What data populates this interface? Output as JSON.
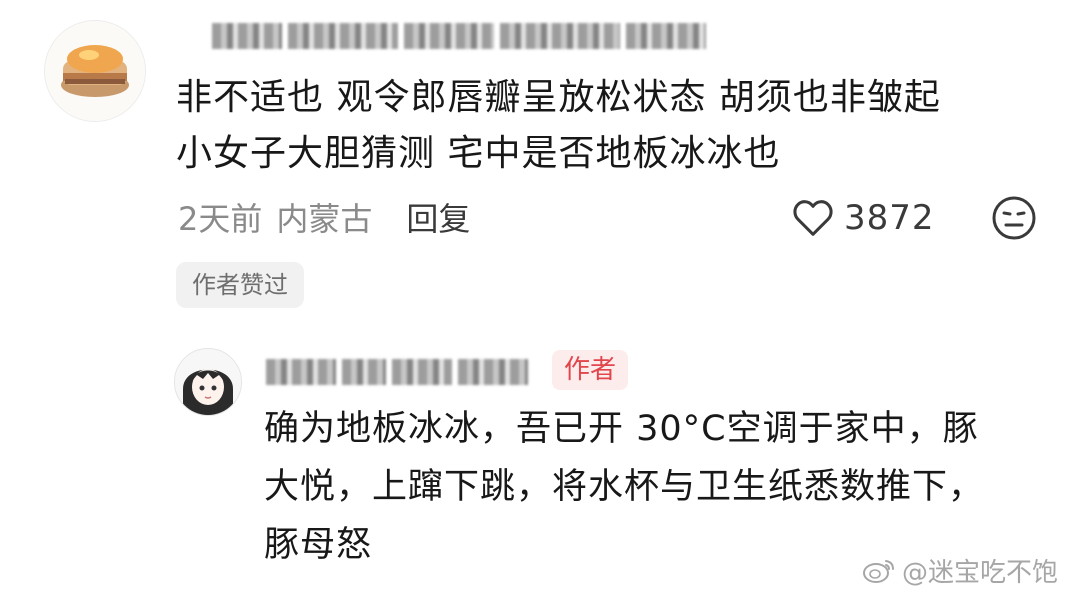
{
  "comment": {
    "avatar_icon": "toast-food-avatar-icon",
    "lines": [
      "非不适也  观令郎唇瓣呈放松状态  胡须也非皱起",
      "小女子大胆猜测  宅中是否地板冰冰也"
    ],
    "time": "2天前",
    "location": "内蒙古",
    "reply_label": "回复",
    "like_count": "3872",
    "like_icon": "heart-outline-icon",
    "emoji_icon": "neutral-face-icon",
    "author_liked_label": "作者赞过"
  },
  "reply": {
    "avatar_icon": "anime-character-avatar-icon",
    "author_badge": "作者",
    "lines": [
      "确为地板冰冰，吾已开 30°C空调于家中，豚",
      "大悦，上蹿下跳，将水杯与卫生纸悉数推下，",
      "豚母怒"
    ]
  },
  "watermark": {
    "icon": "weibo-logo-icon",
    "text": "@迷宝吃不饱"
  },
  "colors": {
    "badge_text": "#e0464b",
    "badge_bg": "#fdecec",
    "meta_text": "#8a8a8a"
  }
}
